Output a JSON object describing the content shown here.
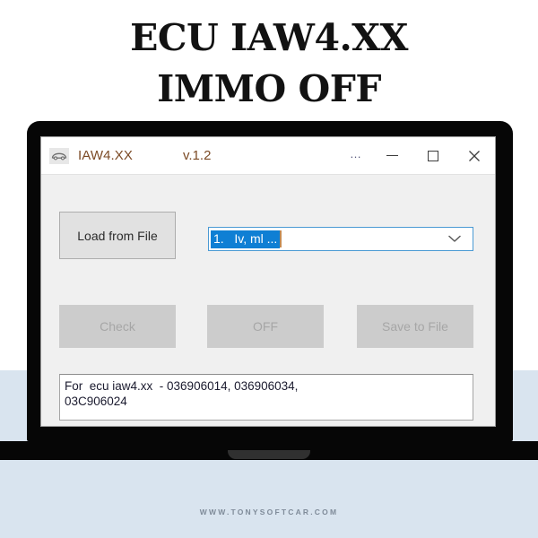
{
  "heading": {
    "line1": "ECU IAW4.XX",
    "line2": "IMMO OFF"
  },
  "window": {
    "icon": "car-icon",
    "title": "IAW4.XX",
    "version": "v.1.2",
    "controls": {
      "more": "…",
      "minimize": "minimize-icon",
      "maximize": "maximize-icon",
      "close": "close-icon"
    }
  },
  "main": {
    "load_button": "Load from File",
    "combo": {
      "value": "1.   Iv, ml ...",
      "arrow": "chevron-down-icon"
    },
    "check_button": "Check",
    "off_button": "OFF",
    "save_button": "Save to File",
    "log_text": "For  ecu iaw4.xx  - 036906014, 036906034,\n03C906024"
  },
  "footer": {
    "url": "WWW.TONYSOFTCAR.COM"
  },
  "colors": {
    "background_lower": "#d9e4ef",
    "laptop": "#060606",
    "title_text": "#7b4a25",
    "selection": "#0f7fd4",
    "combo_border": "#4a9ad4",
    "button_enabled": "#e1e1e1",
    "button_disabled": "#cccccc"
  }
}
